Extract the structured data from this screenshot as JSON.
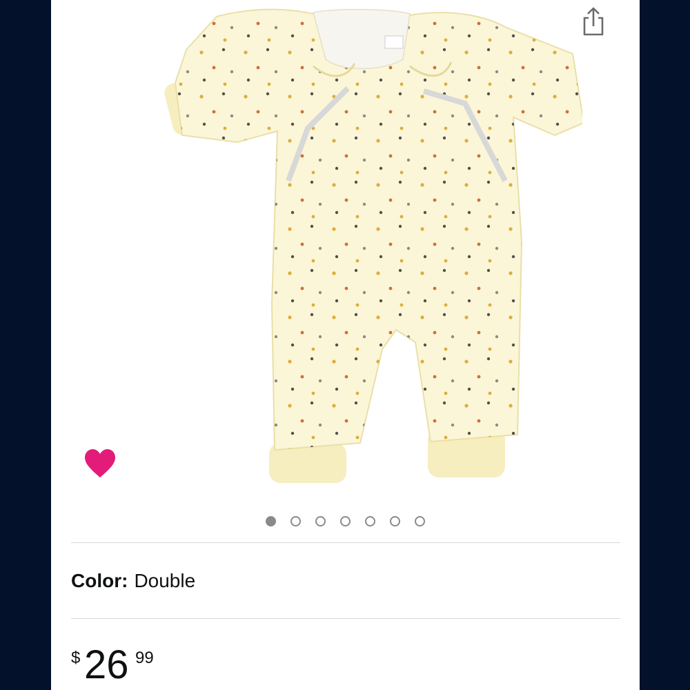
{
  "product": {
    "image_alt": "Cream baby sleep suit with star print and zippered front",
    "gallery_count": 7,
    "gallery_active_index": 0
  },
  "variation": {
    "label": "Color:",
    "value": "Double"
  },
  "price": {
    "currency": "$",
    "whole": "26",
    "fraction": "99"
  },
  "colors": {
    "side_background": "#03112b",
    "wishlist_heart": "#e31c79",
    "garment": "#fbf6d8"
  },
  "icons": {
    "share": "share-icon",
    "wishlist": "heart-icon"
  }
}
